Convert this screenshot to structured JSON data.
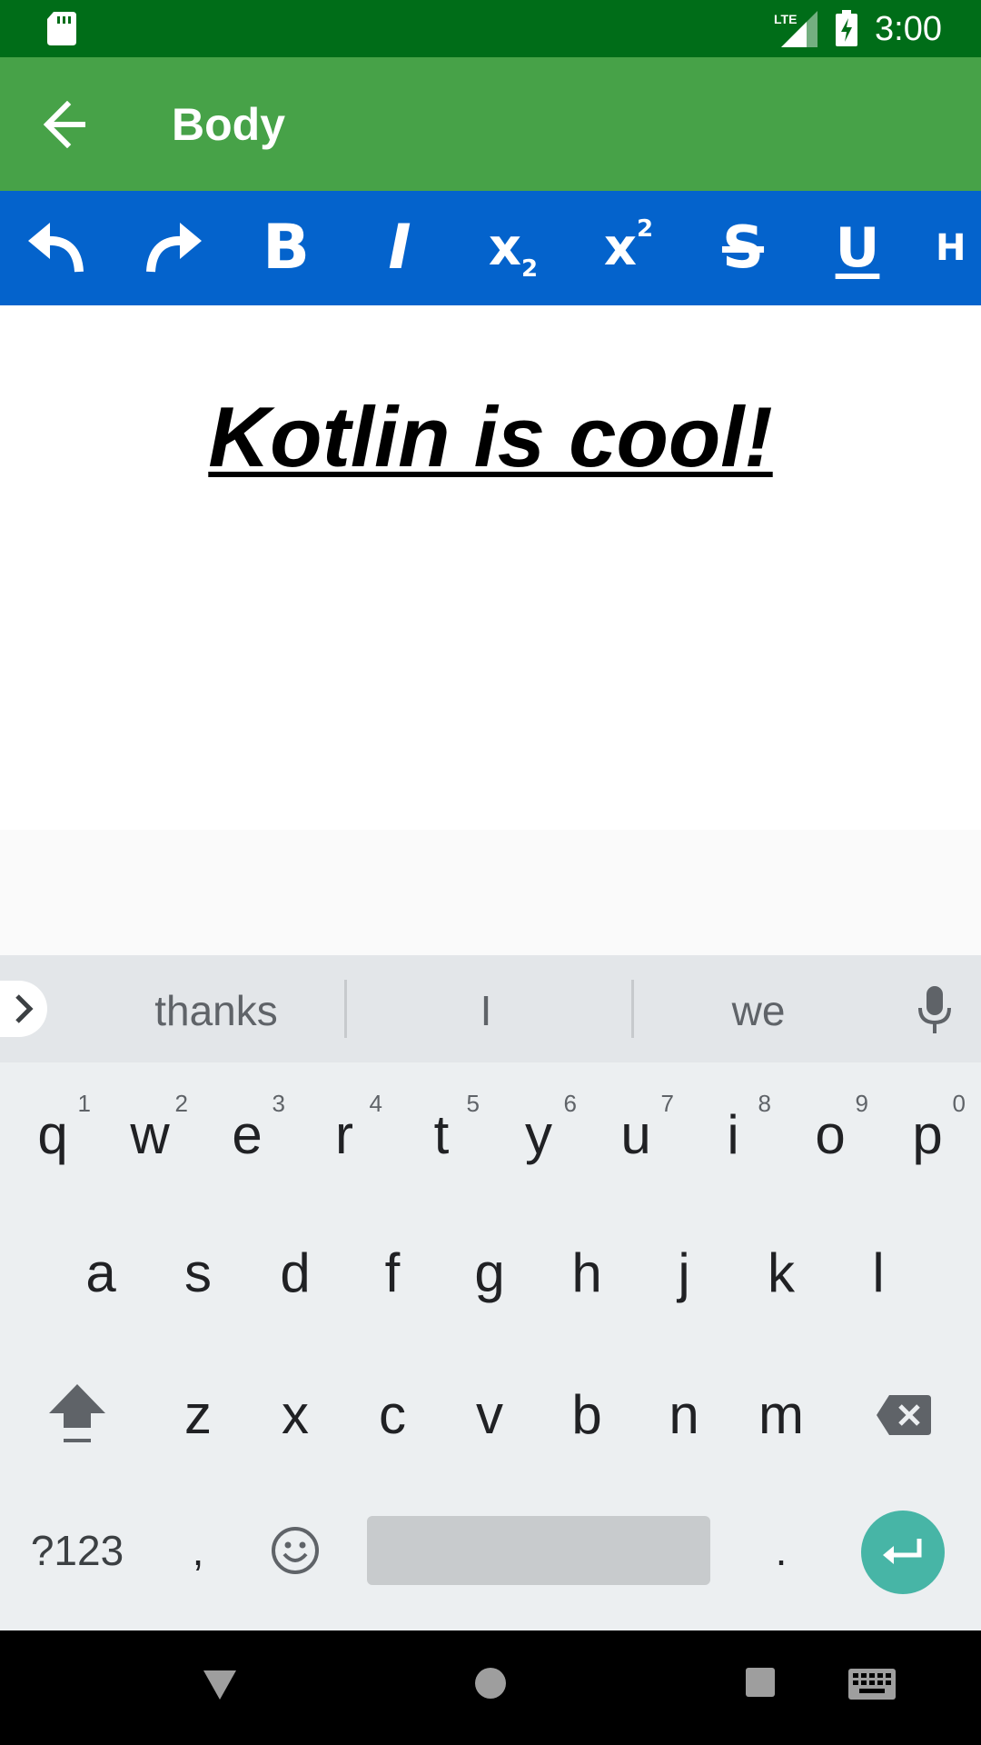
{
  "status_bar": {
    "time": "3:00",
    "network": "LTE"
  },
  "app_bar": {
    "title": "Body"
  },
  "toolbar": {
    "items": [
      {
        "name": "undo"
      },
      {
        "name": "redo"
      },
      {
        "name": "bold",
        "label": "B"
      },
      {
        "name": "italic",
        "label": "I"
      },
      {
        "name": "subscript",
        "label": "x",
        "sub": "2"
      },
      {
        "name": "superscript",
        "label": "x",
        "sup": "2"
      },
      {
        "name": "strikethrough",
        "label": "S"
      },
      {
        "name": "underline",
        "label": "U"
      },
      {
        "name": "heading",
        "label": "H"
      }
    ]
  },
  "editor": {
    "content": "Kotlin is cool!"
  },
  "keyboard": {
    "suggestions": [
      "thanks",
      "I",
      "we"
    ],
    "row1": [
      {
        "key": "q",
        "hint": "1"
      },
      {
        "key": "w",
        "hint": "2"
      },
      {
        "key": "e",
        "hint": "3"
      },
      {
        "key": "r",
        "hint": "4"
      },
      {
        "key": "t",
        "hint": "5"
      },
      {
        "key": "y",
        "hint": "6"
      },
      {
        "key": "u",
        "hint": "7"
      },
      {
        "key": "i",
        "hint": "8"
      },
      {
        "key": "o",
        "hint": "9"
      },
      {
        "key": "p",
        "hint": "0"
      }
    ],
    "row2": [
      "a",
      "s",
      "d",
      "f",
      "g",
      "h",
      "j",
      "k",
      "l"
    ],
    "row3": [
      "z",
      "x",
      "c",
      "v",
      "b",
      "n",
      "m"
    ],
    "symbols_label": "?123",
    "comma": ",",
    "period": "."
  },
  "colors": {
    "status_bar": "#006d18",
    "app_bar": "#47a248",
    "toolbar": "#0463cc",
    "enter_key": "#47b5a6"
  }
}
